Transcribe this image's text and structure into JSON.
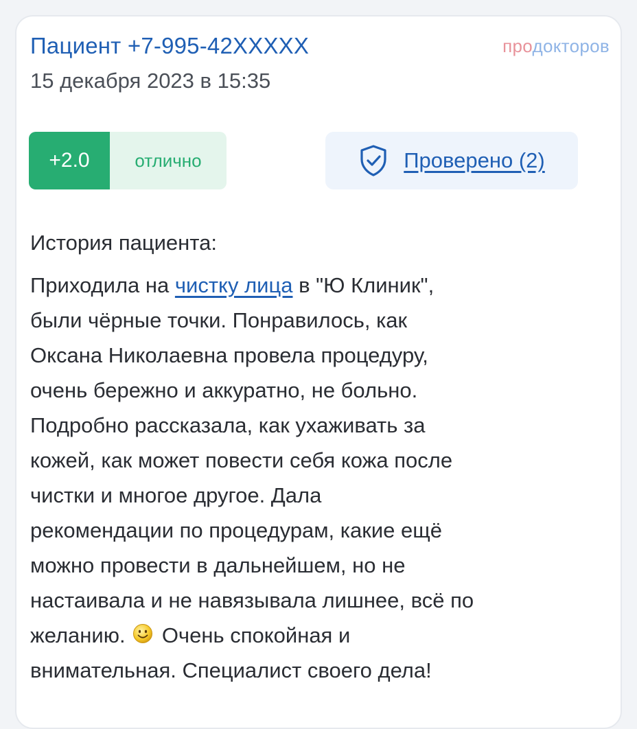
{
  "review": {
    "author": "Пациент +7-995-42XXXXX",
    "date": "15 декабря 2023 в 15:35",
    "brand": {
      "part1": "про",
      "part2": "докторов"
    },
    "rating": {
      "score": "+2.0",
      "label": "отлично"
    },
    "verified": {
      "label": "Проверено (2)",
      "icon": "shield-check-icon"
    },
    "section_title": "История пациента:",
    "body": {
      "l1_before": "Приходила на ",
      "l1_link": "чистку лица",
      "l1_after": " в \"Ю Клиник\",",
      "l2": "были чёрные точки. Понравилось, как",
      "l3": "Оксана Николаевна провела процедуру,",
      "l4": "очень бережно и аккуратно, не больно.",
      "l5": "Подробно рассказала, как ухаживать за",
      "l6": "кожей, как может повести себя кожа после",
      "l7": "чистки и многое другое. Дала",
      "l8": "рекомендации по процедурам, какие ещё",
      "l9": "можно провести в дальнейшем, но не",
      "l10": "настаивала и не навязывала лишнее, всё по",
      "l11_before": "желанию. ",
      "l11_after": " Очень спокойная и",
      "l12": "внимательная. Специалист своего дела!"
    },
    "emoji": "smiley-icon"
  },
  "colors": {
    "accent_blue": "#1f5fb4",
    "rating_green": "#27ad72",
    "rating_bg": "#e4f5ec",
    "verified_bg": "#eef4fc"
  }
}
